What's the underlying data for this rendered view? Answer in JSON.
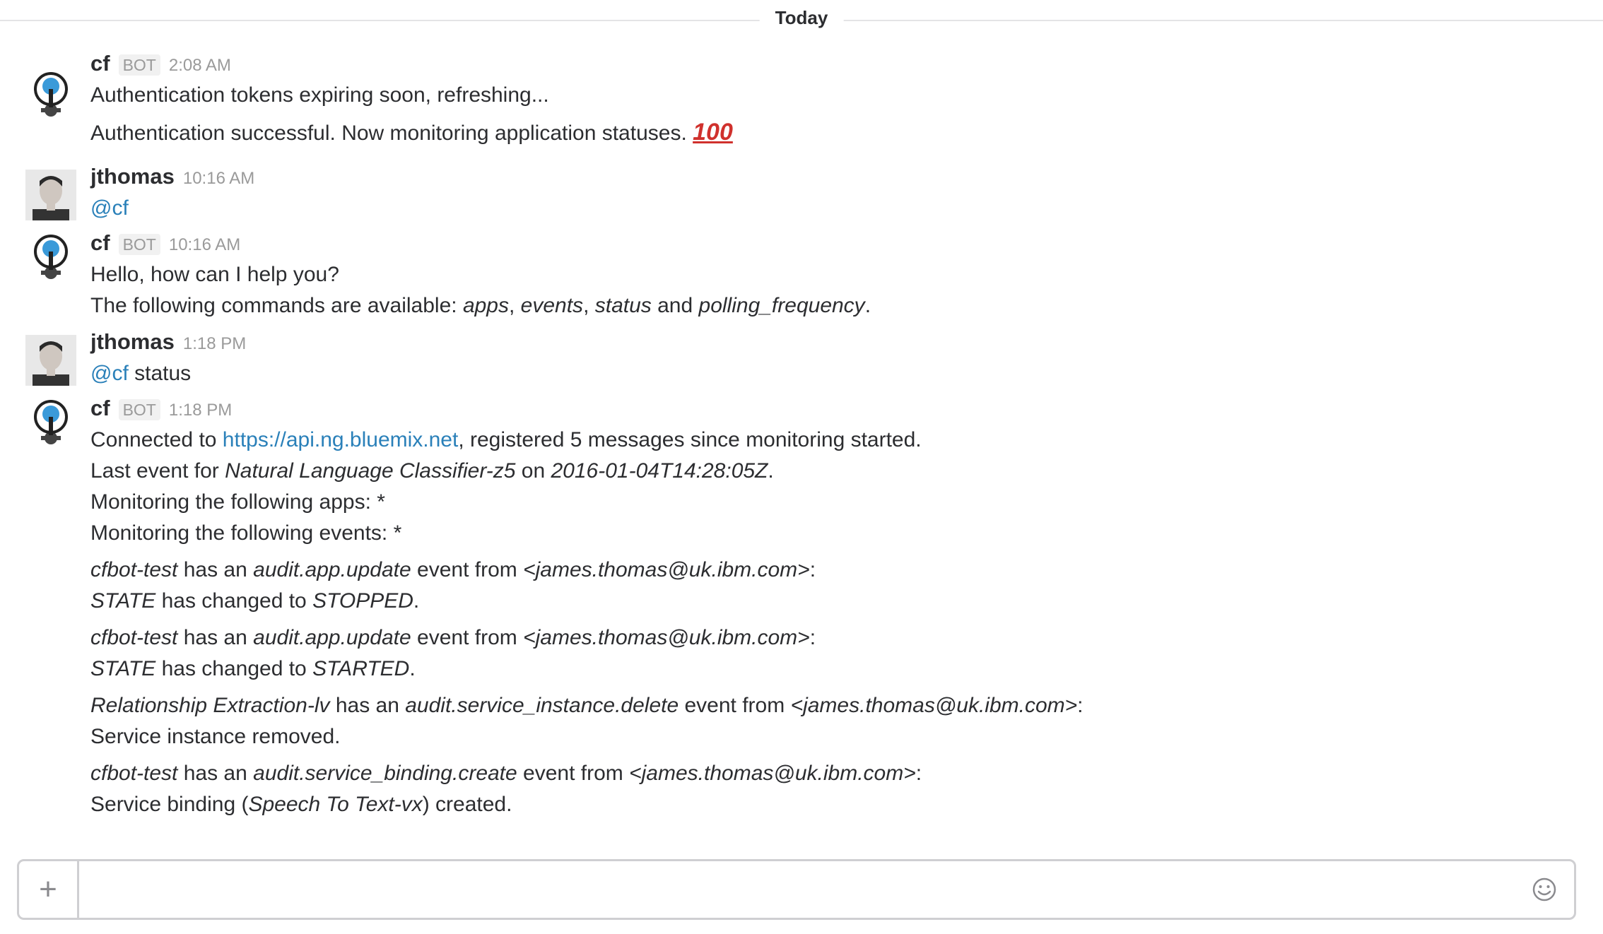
{
  "divider": {
    "label": "Today"
  },
  "messages": [
    {
      "user": "cf",
      "bot_badge": "BOT",
      "time": "2:08 AM",
      "lines": [
        "Authentication tokens expiring soon, refreshing...",
        "Authentication successful. Now monitoring application statuses."
      ],
      "emoji": "100"
    },
    {
      "user": "jthomas",
      "time": "10:16 AM",
      "mention": "@cf",
      "text": ""
    },
    {
      "user": "cf",
      "bot_badge": "BOT",
      "time": "10:16 AM",
      "line1": "Hello, how can I help you?",
      "line2_prefix": "The following commands are available: ",
      "cmd1": "apps",
      "sep1": ", ",
      "cmd2": "events",
      "sep2": ", ",
      "cmd3": "status",
      "and": " and ",
      "cmd4": "polling_frequency",
      "end": "."
    },
    {
      "user": "jthomas",
      "time": "1:18 PM",
      "mention": "@cf",
      "text": " status"
    },
    {
      "user": "cf",
      "bot_badge": "BOT",
      "time": "1:18 PM",
      "connected_prefix": "Connected to ",
      "connected_link": "https://api.ng.bluemix.net",
      "connected_suffix": ", registered 5 messages since monitoring started.",
      "last_prefix": "Last event for ",
      "last_app": "Natural Language Classifier-z5",
      "last_on": " on ",
      "last_time": "2016-01-04T14:28:05Z",
      "last_end": ".",
      "apps_line": "Monitoring the following apps: *",
      "events_line": "Monitoring the following events: *",
      "events": [
        {
          "app": "cfbot-test",
          "has": " has an ",
          "event": "audit.app.update",
          "from": " event from ",
          "email": "<james.thomas@uk.ibm.com>",
          "colon": ":",
          "detail_a": "STATE",
          "detail_b": " has changed to ",
          "detail_c": "STOPPED",
          "detail_d": "."
        },
        {
          "app": "cfbot-test",
          "has": " has an ",
          "event": "audit.app.update",
          "from": " event from ",
          "email": "<james.thomas@uk.ibm.com>",
          "colon": ":",
          "detail_a": "STATE",
          "detail_b": " has changed to ",
          "detail_c": "STARTED",
          "detail_d": "."
        },
        {
          "app": "Relationship Extraction-lv",
          "has": " has an ",
          "event": "audit.service_instance.delete",
          "from": " event from ",
          "email": "<james.thomas@uk.ibm.com>",
          "colon": ":",
          "detail_plain": "Service instance removed."
        },
        {
          "app": "cfbot-test",
          "has": " has an ",
          "event": "audit.service_binding.create",
          "from": " event from ",
          "email": "<james.thomas@uk.ibm.com>",
          "colon": ":",
          "detail_a": "Service binding (",
          "detail_c": "Speech To Text-vx",
          "detail_d": ") created."
        }
      ]
    }
  ],
  "composer": {
    "placeholder": "",
    "plus_label": "+"
  },
  "icons": {
    "bot_avatar": "cf-bot-pin-icon",
    "user_avatar": "user-photo",
    "emoji": "smiley-icon"
  },
  "colors": {
    "link": "#2a80b9",
    "text": "#2c2d30",
    "muted": "#9a9a9a"
  }
}
